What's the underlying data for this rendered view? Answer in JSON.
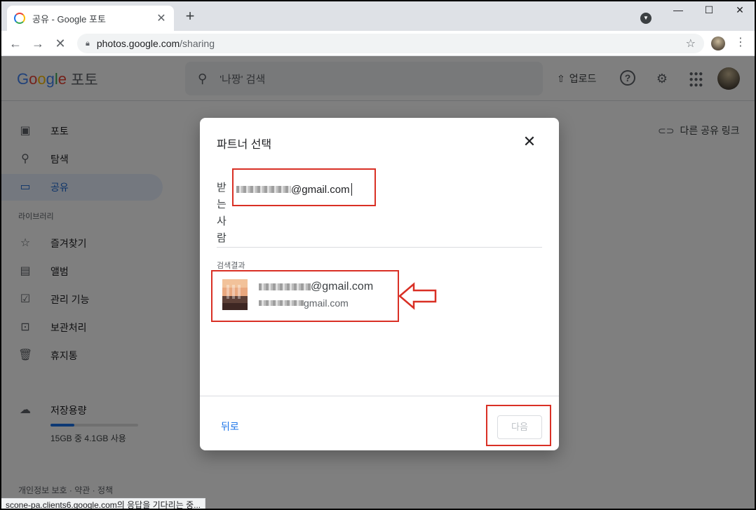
{
  "browser": {
    "tab_title": "공유 - Google 포토",
    "tab_close": "✕",
    "new_tab": "+",
    "win_min": "—",
    "win_max": "☐",
    "win_close": "✕",
    "url_host": "photos.google.com",
    "url_path": "/sharing",
    "status": "scone-pa.clients6.google.com의 응답을 기다리는 중..."
  },
  "header": {
    "logo_letters": [
      "G",
      "o",
      "o",
      "g",
      "l",
      "e"
    ],
    "product": "포토",
    "search_placeholder": "'나짱' 검색",
    "upload_label": "업로드"
  },
  "sidebar": {
    "items": [
      {
        "label": "포토",
        "icon": "photo-icon"
      },
      {
        "label": "탐색",
        "icon": "search-icon"
      },
      {
        "label": "공유",
        "icon": "chat-icon",
        "active": true
      }
    ],
    "library_label": "라이브러리",
    "library_items": [
      {
        "label": "즐겨찾기",
        "icon": "star-icon"
      },
      {
        "label": "앨범",
        "icon": "album-icon"
      },
      {
        "label": "관리 기능",
        "icon": "checklist-icon"
      },
      {
        "label": "보관처리",
        "icon": "archive-icon"
      },
      {
        "label": "휴지통",
        "icon": "trash-icon"
      }
    ],
    "storage_label": "저장용량",
    "storage_usage": "15GB 중 4.1GB 사용",
    "storage_fraction": 0.27,
    "footer": "개인정보 보호 · 약관 · 정책"
  },
  "main": {
    "other_link_label": "다른 공유 링크"
  },
  "dialog": {
    "title": "파트너 선택",
    "recipient_label": [
      "받",
      "는",
      "사",
      "람"
    ],
    "recipient_value_suffix": "@gmail.com",
    "results_label": "검색결과",
    "result_email_suffix": "@gmail.com",
    "result_sub_suffix": "gmail.com",
    "back_label": "뒤로",
    "next_label": "다음"
  },
  "colors": {
    "accent": "#1a73e8",
    "annotation_red": "#d93025",
    "active_bg": "#e8f0fe"
  }
}
